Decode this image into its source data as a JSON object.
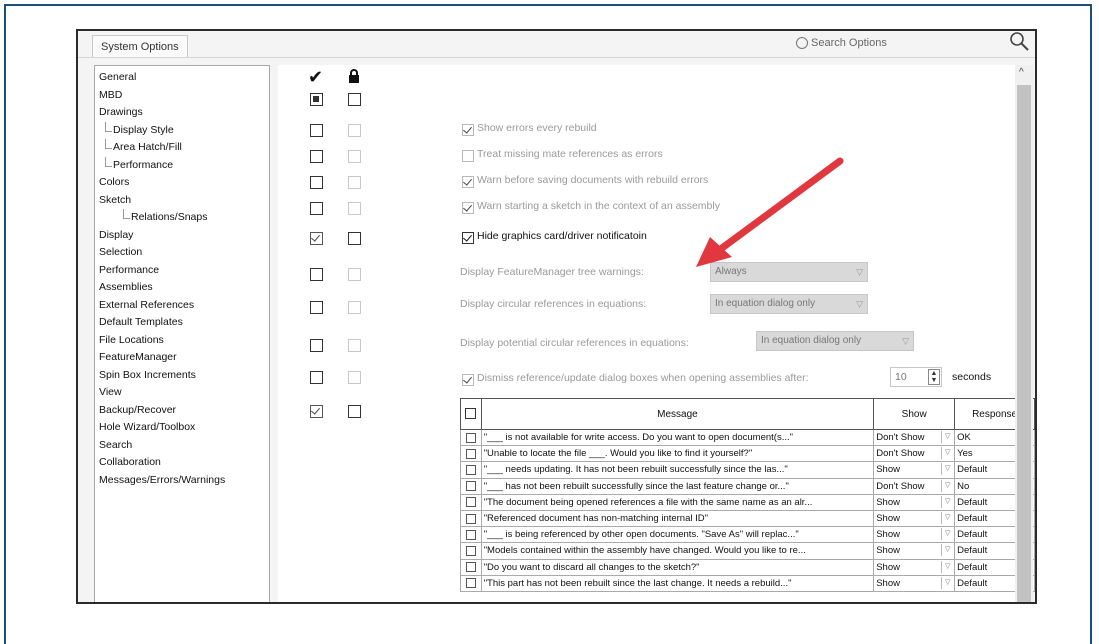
{
  "dialog": {
    "tab_label": "System Options",
    "search_placeholder": "Search Options"
  },
  "tree": [
    {
      "label": "General",
      "level": 0
    },
    {
      "label": "MBD",
      "level": 0
    },
    {
      "label": "Drawings",
      "level": 0
    },
    {
      "label": "Display Style",
      "level": 1
    },
    {
      "label": "Area Hatch/Fill",
      "level": 1
    },
    {
      "label": "Performance",
      "level": 1
    },
    {
      "label": "Colors",
      "level": 0
    },
    {
      "label": "Sketch",
      "level": 0
    },
    {
      "label": "Relations/Snaps",
      "level": 1
    },
    {
      "label": "Display",
      "level": 0
    },
    {
      "label": "Selection",
      "level": 0
    },
    {
      "label": "Performance",
      "level": 0
    },
    {
      "label": "Assemblies",
      "level": 0
    },
    {
      "label": "External References",
      "level": 0
    },
    {
      "label": "Default Templates",
      "level": 0
    },
    {
      "label": "File Locations",
      "level": 0
    },
    {
      "label": "FeatureManager",
      "level": 0
    },
    {
      "label": "Spin Box Increments",
      "level": 0
    },
    {
      "label": "View",
      "level": 0
    },
    {
      "label": "Backup/Recover",
      "level": 0
    },
    {
      "label": "Hole Wizard/Toolbox",
      "level": 0
    },
    {
      "label": "Search",
      "level": 0
    },
    {
      "label": "Collaboration",
      "level": 0
    },
    {
      "label": "Messages/Errors/Warnings",
      "level": 0
    }
  ],
  "options": {
    "show_errors": "Show errors every rebuild",
    "treat_missing": "Treat missing mate references as errors",
    "warn_saving": "Warn before saving documents with rebuild errors",
    "warn_sketch": "Warn starting a sketch in the context of an assembly",
    "hide_graphics": "Hide graphics card/driver notificatoin",
    "fm_tree_warnings": "Display FeatureManager tree warnings:",
    "fm_tree_value": "Always",
    "circular_refs": "Display circular references in equations:",
    "circular_value": "In equation dialog only",
    "potential_circular": "Display potential circular references in equations:",
    "potential_value": "In equation dialog only",
    "dismiss": "Dismiss reference/update dialog boxes when opening assemblies after:",
    "dismiss_value": "10",
    "seconds": "seconds"
  },
  "table": {
    "headers": {
      "message": "Message",
      "show": "Show",
      "response": "Response"
    },
    "rows": [
      {
        "message": "\"___ is not available for write access.  Do you want to open document(s...\"",
        "show": "Don't Show",
        "response": "OK"
      },
      {
        "message": "\"Unable to locate the file ___.  Would you like to find it yourself?\"",
        "show": "Don't Show",
        "response": "Yes"
      },
      {
        "message": "\"___ needs updating.  It has not been rebuilt successfully since the las...\"",
        "show": "Show",
        "response": "Default"
      },
      {
        "message": "\"___ has not been rebuilt successfully since the last feature change or...\"",
        "show": "Don't Show",
        "response": "No"
      },
      {
        "message": "\"The document being opened references a file with the same name as an alr...",
        "show": "Show",
        "response": "Default"
      },
      {
        "message": "\"Referenced document has non-matching internal ID\"",
        "show": "Show",
        "response": "Default"
      },
      {
        "message": "\"___ is being referenced by other open documents.  \"Save As\" will replac...\"",
        "show": "Show",
        "response": "Default"
      },
      {
        "message": "\"Models contained within the assembly have changed.  Would you like to re...",
        "show": "Show",
        "response": "Default"
      },
      {
        "message": "\"Do you want to discard all changes to the sketch?\"",
        "show": "Show",
        "response": "Default"
      },
      {
        "message": "\"This part has not been rebuilt since the last change. It needs a rebuild...\"",
        "show": "Show",
        "response": "Default"
      }
    ]
  },
  "colors": {
    "frame": "#1f4e79",
    "arrow": "#e0383e"
  }
}
